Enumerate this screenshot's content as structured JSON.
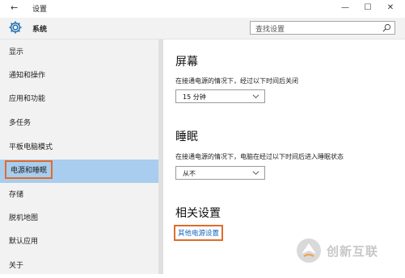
{
  "window": {
    "back_glyph": "←",
    "title": "设置",
    "minimize_glyph": "—",
    "maximize_glyph": "☐",
    "close_glyph": "✕"
  },
  "header": {
    "app_name": "系统",
    "search_placeholder": "查找设置",
    "accent": "#1a6fb5"
  },
  "sidebar": {
    "items": [
      {
        "label": "显示"
      },
      {
        "label": "通知和操作"
      },
      {
        "label": "应用和功能"
      },
      {
        "label": "多任务"
      },
      {
        "label": "平板电脑模式"
      },
      {
        "label": "电源和睡眠",
        "selected": true
      },
      {
        "label": "存储"
      },
      {
        "label": "脱机地图"
      },
      {
        "label": "默认应用"
      },
      {
        "label": "关于"
      }
    ],
    "selected_color": "#a8cdee",
    "highlight_color": "#e06b2a"
  },
  "main": {
    "screen": {
      "title": "屏幕",
      "desc": "在接通电源的情况下，经过以下时间后关闭",
      "value": "15 分钟"
    },
    "sleep": {
      "title": "睡眠",
      "desc": "在接通电源的情况下，电脑在经过以下时间后进入睡眠状态",
      "value": "从不"
    },
    "related": {
      "title": "相关设置",
      "link": "其他电源设置"
    }
  },
  "watermark": {
    "text": "创新互联",
    "icon": "fox-logo-icon"
  }
}
